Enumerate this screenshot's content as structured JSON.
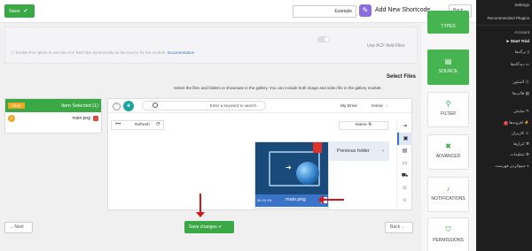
{
  "topbar": {
    "save_label": "Save",
    "shortcode_value": "Example",
    "title": "Add New Shortcode",
    "back_label": "Back"
  },
  "acf": {
    "toggle_label": "Use ACF field Files",
    "description": "Enable this option to use the ACF field files dynamically as the source for the module.",
    "doc_link": "Documentation"
  },
  "select_files": {
    "title": "Select Files",
    "description": "Select the files and folders to showcase in the gallery. You can include both image and video file in the gallery module."
  },
  "selected_panel": {
    "clear_label": "Clear",
    "count_label": "Item Selected (1)",
    "items": [
      {
        "name": "main.png"
      }
    ]
  },
  "file_manager": {
    "search_placeholder": "Enter a keyword to search",
    "breadcrumb": [
      "My Drive",
      "Home"
    ],
    "refresh_label": "Refresh",
    "sort_label": "Name",
    "previous_folder": "Previous folder",
    "file": {
      "name": "main.png",
      "size": "88.99 KB"
    }
  },
  "bottom": {
    "next_label": "Next",
    "save_changes_label": "Save changes",
    "back_label": "Back"
  },
  "steps": [
    {
      "label": "TYPES"
    },
    {
      "label": "SOURCE"
    },
    {
      "label": "FILTER"
    },
    {
      "label": "ADVANCED"
    },
    {
      "label": "NOTIFICATIONS"
    },
    {
      "label": "PERMISSIONS"
    }
  ],
  "wp_menu": {
    "settings": "Settings",
    "recommended": "Recommended Plugins",
    "account": "Account",
    "start_trial": "Start Trial",
    "items": [
      "برگه‌ها",
      "دیدگاه‌ها",
      "المنتور",
      "قالب‌ها",
      "نمایش",
      "افزونه‌ها",
      "کاربران",
      "ابزارها",
      "تنظیمات",
      "جمع‌کردن فهرست"
    ],
    "plugin_badge": "1"
  },
  "colors": {
    "green": "#3aa845",
    "blue": "#3b73c7",
    "orange": "#f5a623",
    "red": "#d3171b"
  }
}
